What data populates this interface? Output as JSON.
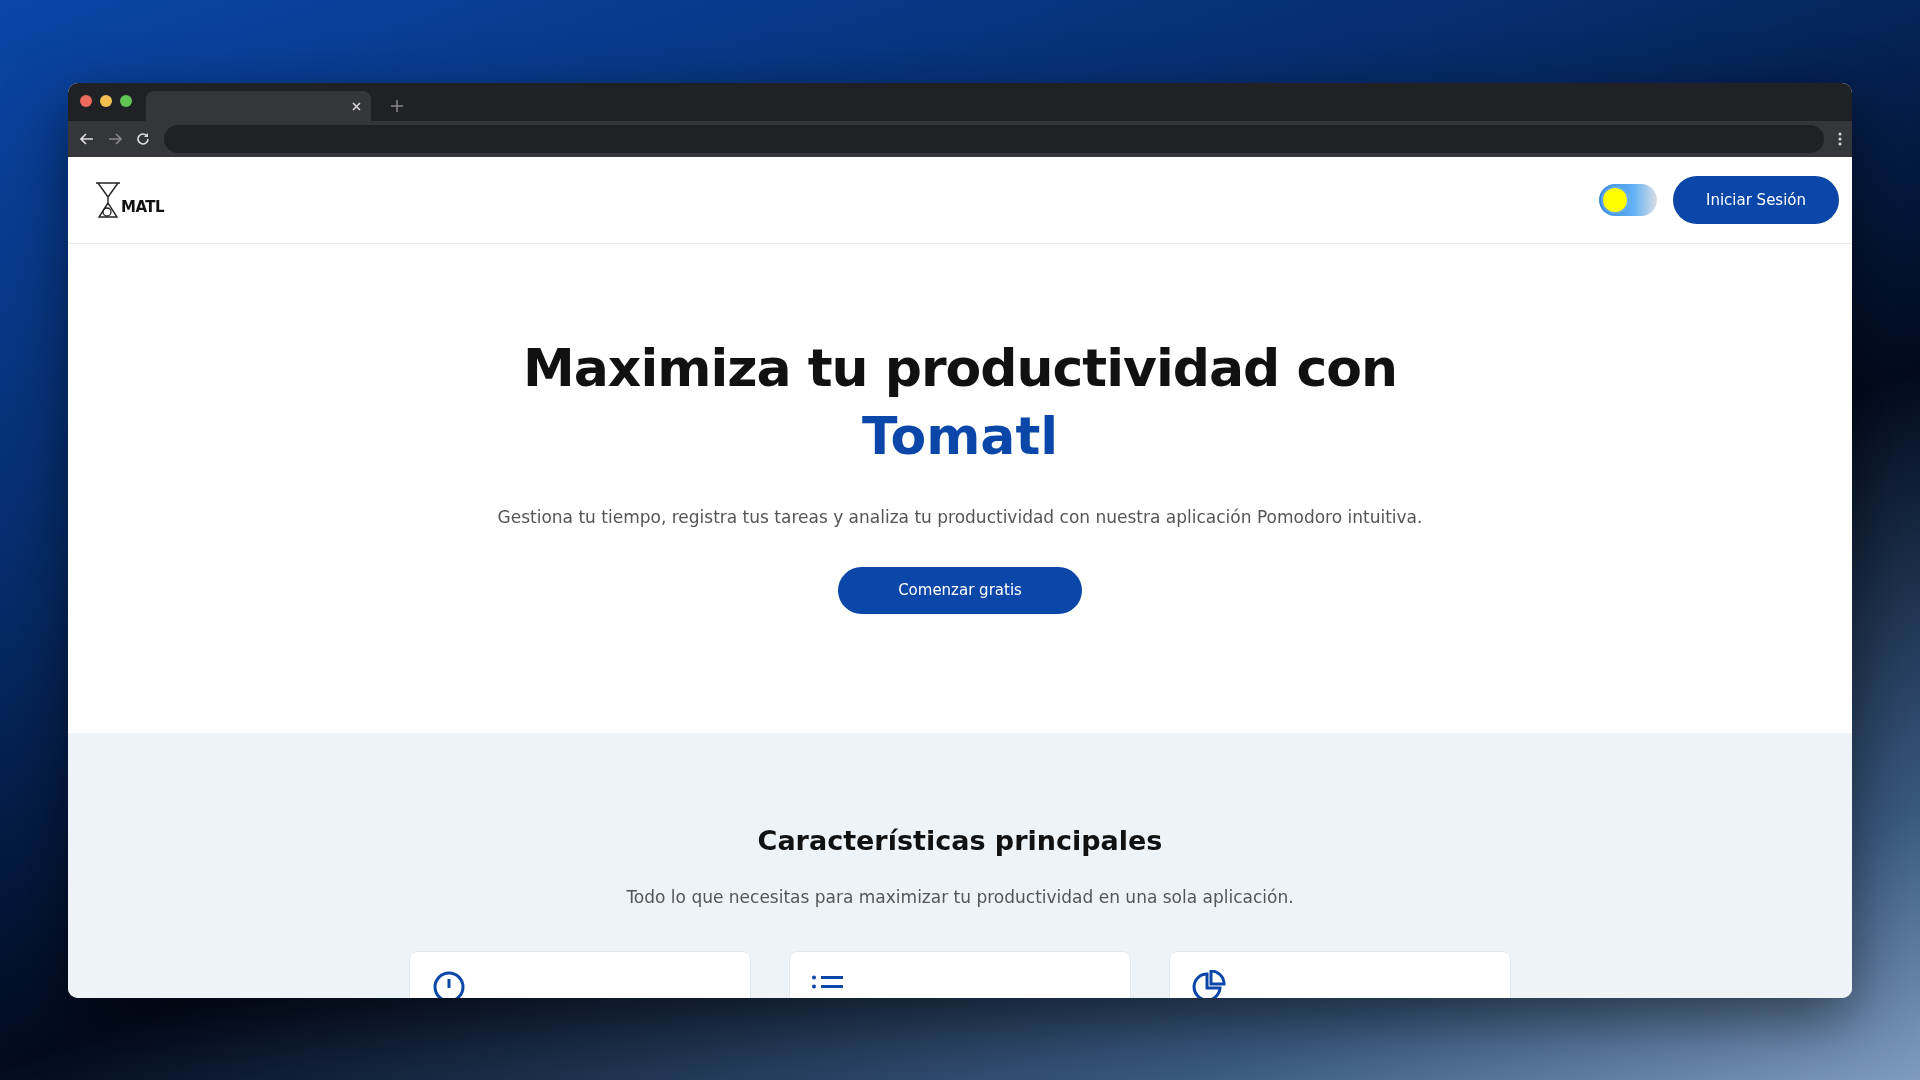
{
  "browser": {
    "tabs": [
      {
        "selected": true
      }
    ]
  },
  "navbar": {
    "logo_text": "MATL",
    "theme_toggle": {
      "dark": false
    },
    "login_button": "Iniciar Sesión"
  },
  "hero": {
    "title": "Maximiza tu productividad con",
    "brand": "Tomatl",
    "subtitle": "Gestiona tu tiempo, registra tus tareas y analiza tu productividad con nuestra aplicación Pomodoro intuitiva.",
    "cta": "Comenzar gratis"
  },
  "features": {
    "title": "Características principales",
    "subtitle": "Todo lo que necesitas para maximizar tu productividad en una sola aplicación.",
    "cards": [
      {
        "kind": "clock"
      },
      {
        "kind": "list"
      },
      {
        "kind": "pie"
      }
    ]
  }
}
